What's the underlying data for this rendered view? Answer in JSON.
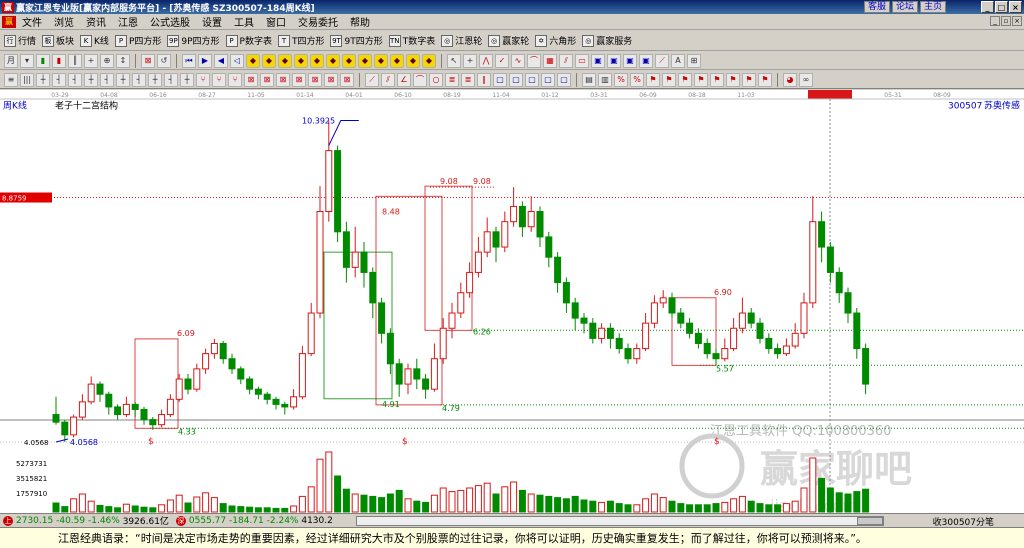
{
  "window": {
    "title": "赢家江恩专业版[赢家内部服务平台] - [苏奥传感  SZ300507-184周K线]",
    "links": [
      "客服",
      "论坛",
      "主页"
    ],
    "logo": "赢"
  },
  "menu": [
    "文件",
    "浏览",
    "资讯",
    "江恩",
    "公式选股",
    "设置",
    "工具",
    "窗口",
    "交易委托",
    "帮助"
  ],
  "toolbar1": [
    {
      "icon": "行",
      "label": "行情"
    },
    {
      "icon": "板",
      "label": "板块"
    },
    {
      "icon": "K",
      "label": "K线"
    },
    {
      "icon": "P",
      "label": "P四方形"
    },
    {
      "icon": "9P",
      "label": "9P四方形"
    },
    {
      "icon": "P",
      "label": "P数字表"
    },
    {
      "icon": "T",
      "label": "T四方形"
    },
    {
      "icon": "9T",
      "label": "9T四方形"
    },
    {
      "icon": "TN",
      "label": "T数字表"
    },
    {
      "icon": "◎",
      "label": "江恩轮"
    },
    {
      "icon": "◎",
      "label": "赢家轮"
    },
    {
      "icon": "✡",
      "label": "六角形"
    },
    {
      "icon": "◎",
      "label": "赢家服务"
    }
  ],
  "chart": {
    "period_label": "周K线",
    "title": "老子十二宫结构",
    "stock_code": "300507",
    "stock_name": "苏奥传感",
    "time_ticks": [
      "03-29",
      "04-08",
      "06-16",
      "08-27",
      "11-05",
      "01-14",
      "04-01",
      "06-10",
      "08-19",
      "11-04",
      "01-12",
      "03-31",
      "06-09",
      "08-18",
      "11-03",
      "2023-12-22",
      "03-22",
      "05-31",
      "08-09"
    ],
    "price_tag": "8.8759",
    "low_tag": "4.0568",
    "labels": {
      "high": "10.3925",
      "low": "4.0568",
      "b1_top": "6.09",
      "b1_bottom": "4.33",
      "b3_top": "8.48",
      "b3_bottom": "4.91",
      "b4_top": "9.08",
      "b4_top2": "9.08",
      "b4_bottom": "6.26",
      "b3_bottom2": "4.79",
      "b5_top": "6.90",
      "b5_bottom": "5.57"
    },
    "dividend_mark": "$",
    "watermark": "江恩工具软件  QQ:100800360",
    "watermark_logo": "赢家聊吧",
    "watermark_url": "jiaoba.com",
    "volume_labels": [
      "5273731",
      "3515821",
      "1757910"
    ],
    "colors": {
      "up": "#d81818",
      "down": "#008a00",
      "box_red": "#d81818",
      "box_green": "#008a00"
    }
  },
  "chart_data": {
    "type": "candlestick",
    "title": "老子十二宫结构",
    "ylim": [
      4.0,
      10.6
    ],
    "candles": [
      [
        4.6,
        4.45,
        4.95,
        4.4
      ],
      [
        4.45,
        4.2,
        4.5,
        4.06
      ],
      [
        4.2,
        4.55,
        4.6,
        4.15
      ],
      [
        4.55,
        4.85,
        5.0,
        4.5
      ],
      [
        4.85,
        5.2,
        5.35,
        4.8
      ],
      [
        5.2,
        5.0,
        5.25,
        4.85
      ],
      [
        5.0,
        4.75,
        5.05,
        4.6
      ],
      [
        4.75,
        4.6,
        4.8,
        4.5
      ],
      [
        4.6,
        4.8,
        4.95,
        4.55
      ],
      [
        4.8,
        4.7,
        4.85,
        4.55
      ],
      [
        4.7,
        4.5,
        4.75,
        4.4
      ],
      [
        4.5,
        4.4,
        4.55,
        4.3
      ],
      [
        4.4,
        4.6,
        4.7,
        4.35
      ],
      [
        4.6,
        4.9,
        5.0,
        4.55
      ],
      [
        4.9,
        5.3,
        5.4,
        4.85
      ],
      [
        5.3,
        5.1,
        5.4,
        5.0
      ],
      [
        5.1,
        5.5,
        5.6,
        5.05
      ],
      [
        5.5,
        5.8,
        5.9,
        5.4
      ],
      [
        5.8,
        6.0,
        6.09,
        5.7
      ],
      [
        6.0,
        5.7,
        6.05,
        5.6
      ],
      [
        5.7,
        5.5,
        5.8,
        5.4
      ],
      [
        5.5,
        5.3,
        5.55,
        5.2
      ],
      [
        5.3,
        5.1,
        5.35,
        5.0
      ],
      [
        5.1,
        5.0,
        5.15,
        4.9
      ],
      [
        5.0,
        4.9,
        5.05,
        4.8
      ],
      [
        4.9,
        4.8,
        4.95,
        4.7
      ],
      [
        4.8,
        4.75,
        4.85,
        4.6
      ],
      [
        4.75,
        4.95,
        5.1,
        4.7
      ],
      [
        4.95,
        5.8,
        5.95,
        4.9
      ],
      [
        5.8,
        6.6,
        6.8,
        5.75
      ],
      [
        6.6,
        8.6,
        9.1,
        6.5
      ],
      [
        8.6,
        9.8,
        10.39,
        8.4
      ],
      [
        9.8,
        8.2,
        9.9,
        8.0
      ],
      [
        8.2,
        7.5,
        8.4,
        7.2
      ],
      [
        7.5,
        7.8,
        8.3,
        7.3
      ],
      [
        7.8,
        7.4,
        8.0,
        7.1
      ],
      [
        7.4,
        6.8,
        7.5,
        6.5
      ],
      [
        6.8,
        6.2,
        6.9,
        6.0
      ],
      [
        6.2,
        5.6,
        6.3,
        5.4
      ],
      [
        5.6,
        5.2,
        5.7,
        4.95
      ],
      [
        5.2,
        5.5,
        5.6,
        5.0
      ],
      [
        5.5,
        5.3,
        5.7,
        5.1
      ],
      [
        5.3,
        5.1,
        5.4,
        4.91
      ],
      [
        5.1,
        5.7,
        6.0,
        5.05
      ],
      [
        5.7,
        6.3,
        6.5,
        5.6
      ],
      [
        6.3,
        6.6,
        6.8,
        6.1
      ],
      [
        6.6,
        7.0,
        7.2,
        6.5
      ],
      [
        7.0,
        7.4,
        7.6,
        6.9
      ],
      [
        7.4,
        7.8,
        8.1,
        7.3
      ],
      [
        7.8,
        8.2,
        8.48,
        7.7
      ],
      [
        8.2,
        7.9,
        8.3,
        7.6
      ],
      [
        7.9,
        8.4,
        8.6,
        7.8
      ],
      [
        8.4,
        8.7,
        9.08,
        8.3
      ],
      [
        8.7,
        8.3,
        8.8,
        8.1
      ],
      [
        8.3,
        8.6,
        8.9,
        8.2
      ],
      [
        8.6,
        8.1,
        8.7,
        7.9
      ],
      [
        8.1,
        7.7,
        8.2,
        7.5
      ],
      [
        7.7,
        7.2,
        7.8,
        7.0
      ],
      [
        7.2,
        6.8,
        7.3,
        6.6
      ],
      [
        6.8,
        6.5,
        6.9,
        6.26
      ],
      [
        6.5,
        6.4,
        6.6,
        6.2
      ],
      [
        6.4,
        6.1,
        6.5,
        6.0
      ],
      [
        6.1,
        6.3,
        6.4,
        6.0
      ],
      [
        6.3,
        6.1,
        6.4,
        5.9
      ],
      [
        6.1,
        5.9,
        6.2,
        5.8
      ],
      [
        5.9,
        5.7,
        6.0,
        5.6
      ],
      [
        5.7,
        5.9,
        6.0,
        5.6
      ],
      [
        5.9,
        6.4,
        6.6,
        5.85
      ],
      [
        6.4,
        6.8,
        6.95,
        6.3
      ],
      [
        6.8,
        6.9,
        7.05,
        6.7
      ],
      [
        6.9,
        6.6,
        7.0,
        6.5
      ],
      [
        6.6,
        6.4,
        6.7,
        6.3
      ],
      [
        6.4,
        6.2,
        6.5,
        6.1
      ],
      [
        6.2,
        6.0,
        6.3,
        5.9
      ],
      [
        6.0,
        5.8,
        6.1,
        5.7
      ],
      [
        5.8,
        5.7,
        5.9,
        5.57
      ],
      [
        5.7,
        5.9,
        6.1,
        5.65
      ],
      [
        5.9,
        6.3,
        6.5,
        5.85
      ],
      [
        6.3,
        6.6,
        6.9,
        6.2
      ],
      [
        6.6,
        6.4,
        6.7,
        6.3
      ],
      [
        6.4,
        6.1,
        6.5,
        6.0
      ],
      [
        6.1,
        5.9,
        6.2,
        5.8
      ],
      [
        5.9,
        5.8,
        6.0,
        5.7
      ],
      [
        5.8,
        5.95,
        6.1,
        5.75
      ],
      [
        5.95,
        6.2,
        6.4,
        5.9
      ],
      [
        6.2,
        6.8,
        7.0,
        6.1
      ],
      [
        6.8,
        8.4,
        8.9,
        6.7
      ],
      [
        8.4,
        7.9,
        8.6,
        7.6
      ],
      [
        7.9,
        7.4,
        8.0,
        7.2
      ],
      [
        7.4,
        7.0,
        7.5,
        6.8
      ],
      [
        7.0,
        6.6,
        7.1,
        6.4
      ],
      [
        6.6,
        5.9,
        6.7,
        5.7
      ],
      [
        5.9,
        5.2,
        6.0,
        5.0
      ]
    ],
    "volumes": [
      15,
      9,
      22,
      30,
      18,
      11,
      9,
      7,
      13,
      10,
      8,
      7,
      12,
      20,
      28,
      15,
      25,
      32,
      24,
      14,
      10,
      9,
      8,
      7,
      7,
      6,
      6,
      10,
      26,
      42,
      88,
      100,
      60,
      38,
      30,
      28,
      26,
      24,
      30,
      36,
      22,
      18,
      16,
      28,
      40,
      34,
      36,
      40,
      44,
      48,
      30,
      42,
      50,
      36,
      30,
      28,
      26,
      24,
      22,
      26,
      20,
      18,
      16,
      18,
      14,
      12,
      12,
      22,
      30,
      24,
      18,
      14,
      12,
      12,
      12,
      14,
      16,
      22,
      26,
      18,
      14,
      12,
      12,
      14,
      18,
      40,
      90,
      56,
      40,
      32,
      30,
      34,
      38
    ],
    "xlabel": "",
    "ylabel": ""
  },
  "status": {
    "sh_index": "2730.15",
    "sh_change": "-40.59",
    "sh_pct": "-1.46%",
    "sh_amount": "3926.61亿",
    "sz_index": "0555.77",
    "sz_change": "-184.71",
    "sz_pct": "-2.24%",
    "sz_amount": "4130.2",
    "right_text": "收300507分笔"
  },
  "footer": {
    "quote": "江恩经典语录：“时间是决定市场走势的重要因素，经过详细研究大市及个别股票的过往记录，你将可以证明，历史确实重复发生；而了解过往，你将可以预测将来。”。"
  }
}
